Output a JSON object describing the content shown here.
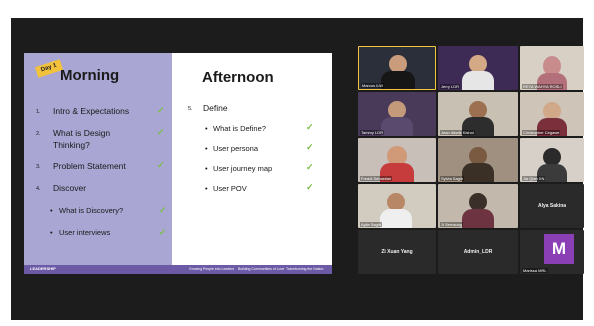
{
  "slide": {
    "day_badge": "Day 1",
    "morning_title": "Morning",
    "afternoon_title": "Afternoon",
    "morning_items": [
      {
        "num": "1.",
        "text": "Intro & Expectations"
      },
      {
        "num": "2.",
        "text": "What is Design"
      },
      {
        "num": "",
        "text": "Thinking?"
      },
      {
        "num": "3.",
        "text": "Problem Statement"
      },
      {
        "num": "4.",
        "text": "Discover"
      }
    ],
    "morning_subitems": [
      "What is Discovery?",
      "User interviews"
    ],
    "afternoon_section": {
      "num": "5.",
      "text": "Define"
    },
    "afternoon_subitems": [
      "What is Define?",
      "User persona",
      "User journey map",
      "User POV"
    ],
    "check_glyph": "✓",
    "bullet": "•",
    "footer_logo": "LEADERSHIP",
    "footer_texts": [
      "Growing People into Leaders",
      "Building Communities of Love",
      "Transforming the Nation"
    ]
  },
  "participants": [
    {
      "name": "Marcus ILW",
      "active": true
    },
    {
      "name": "Jerry LDR",
      "active": false
    },
    {
      "name": "REYA WAHYA ROSLI",
      "active": false
    },
    {
      "name": "Tammy LDR",
      "active": false
    },
    {
      "name": "Jean dikwik Kishol",
      "active": false
    },
    {
      "name": "Christopher Cegawe",
      "active": false
    },
    {
      "name": "Freddi Sebastian",
      "active": false
    },
    {
      "name": "Sylvia Sagib",
      "active": false
    },
    {
      "name": "Jia Qian XN",
      "active": false
    },
    {
      "name": "Aylia Sagib",
      "active": false
    },
    {
      "name": "Ji Sernsung",
      "active": false
    },
    {
      "name": "Alya Sakina",
      "active": false
    },
    {
      "name": "Zi Xuan Yang",
      "active": false
    },
    {
      "name": "Admin_LDR",
      "active": false
    },
    {
      "name": "Marissa MRL",
      "active": false
    }
  ],
  "avatar_letter": "M",
  "mic_glyph": "⁂",
  "colors": {
    "slide_left": "#a9a6d3",
    "footer": "#6c5aa6",
    "badge": "#f2c23c",
    "check": "#7bbf4b",
    "avatar": "#8a3fb5",
    "active_border": "#f5c542"
  }
}
